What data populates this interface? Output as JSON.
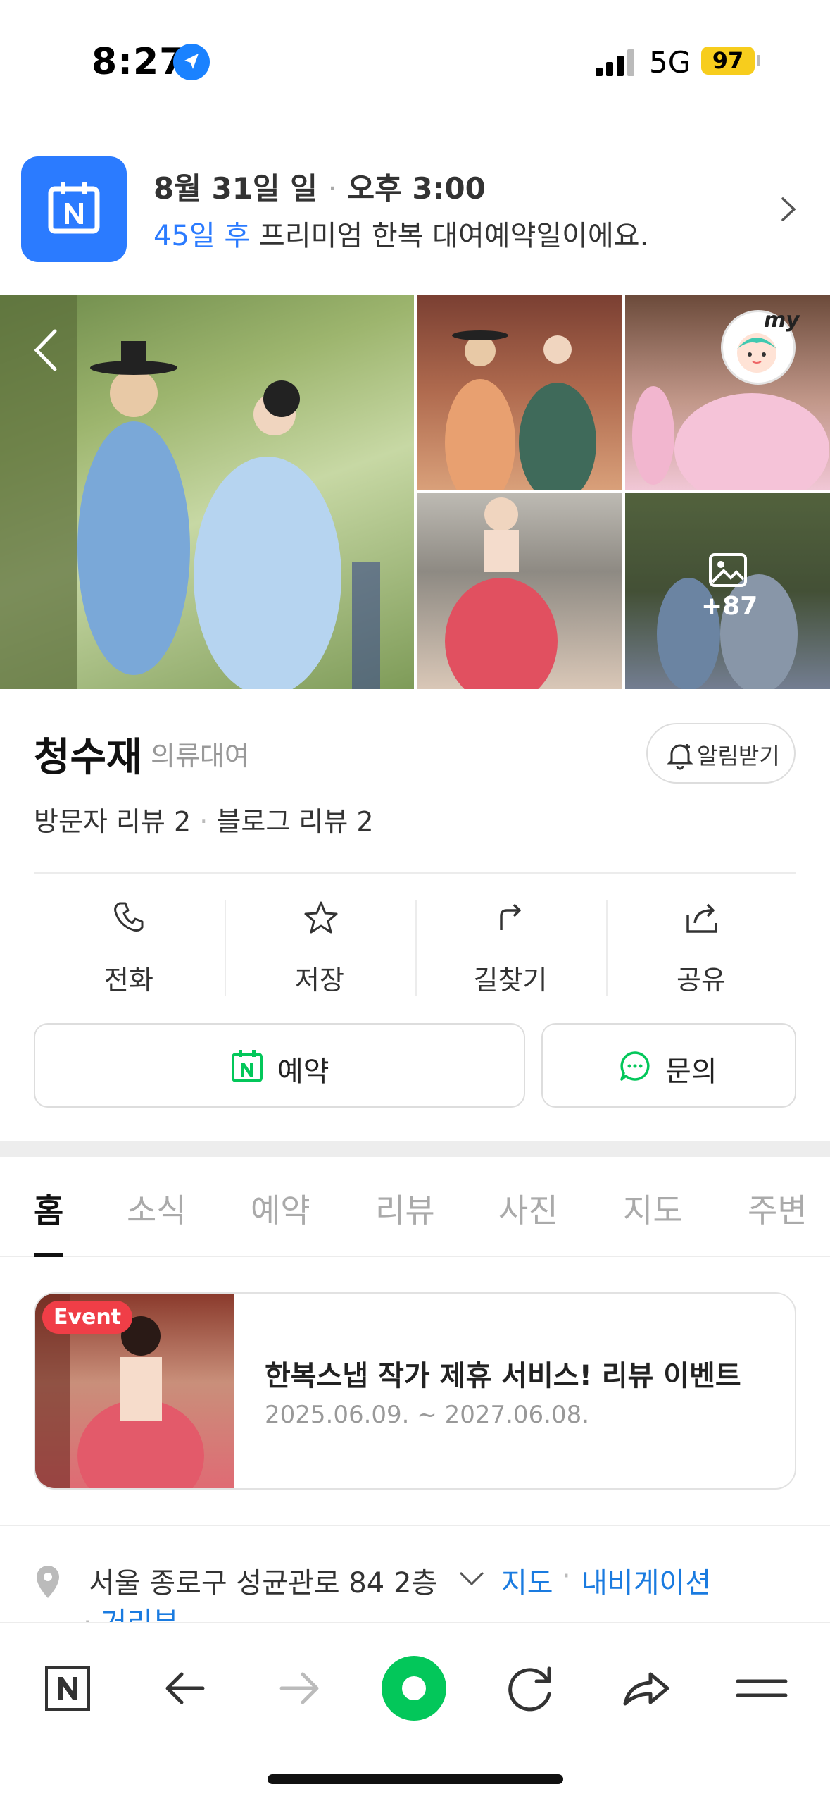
{
  "status_bar": {
    "time": "8:27",
    "network": "5G",
    "battery": "97"
  },
  "reminder": {
    "date": "8월 31일 일",
    "time": "오후 3:00",
    "days_highlight": "45일 후",
    "message": "프리미엄 한복 대여예약일이에요."
  },
  "gallery": {
    "more_count": "+87",
    "profile_badge_text": "my"
  },
  "place": {
    "name": "청수재",
    "category": "의류대여",
    "notify_label": "알림받기",
    "visitor_reviews": "방문자 리뷰 2",
    "blog_reviews": "블로그 리뷰 2"
  },
  "actions": [
    {
      "label": "전화",
      "icon": "phone-icon"
    },
    {
      "label": "저장",
      "icon": "star-icon"
    },
    {
      "label": "길찾기",
      "icon": "directions-icon"
    },
    {
      "label": "공유",
      "icon": "share-icon"
    }
  ],
  "buttons": {
    "reserve": "예약",
    "inquiry": "문의"
  },
  "tabs": [
    "홈",
    "소식",
    "예약",
    "리뷰",
    "사진",
    "지도",
    "주변"
  ],
  "active_tab": "홈",
  "event": {
    "badge": "Event",
    "title": "한복스냅 작가 제휴 서비스! 리뷰 이벤트",
    "period": "2025.06.09. ~ 2027.06.08."
  },
  "address": {
    "text": "서울 종로구 성균관로 84 2층",
    "map_link": "지도",
    "nav_link": "내비게이션",
    "route_link": "거리뷰"
  },
  "colors": {
    "accent": "#2b7bff",
    "green": "#03c75a",
    "event_red": "#f03e47",
    "link": "#1a7be0"
  }
}
